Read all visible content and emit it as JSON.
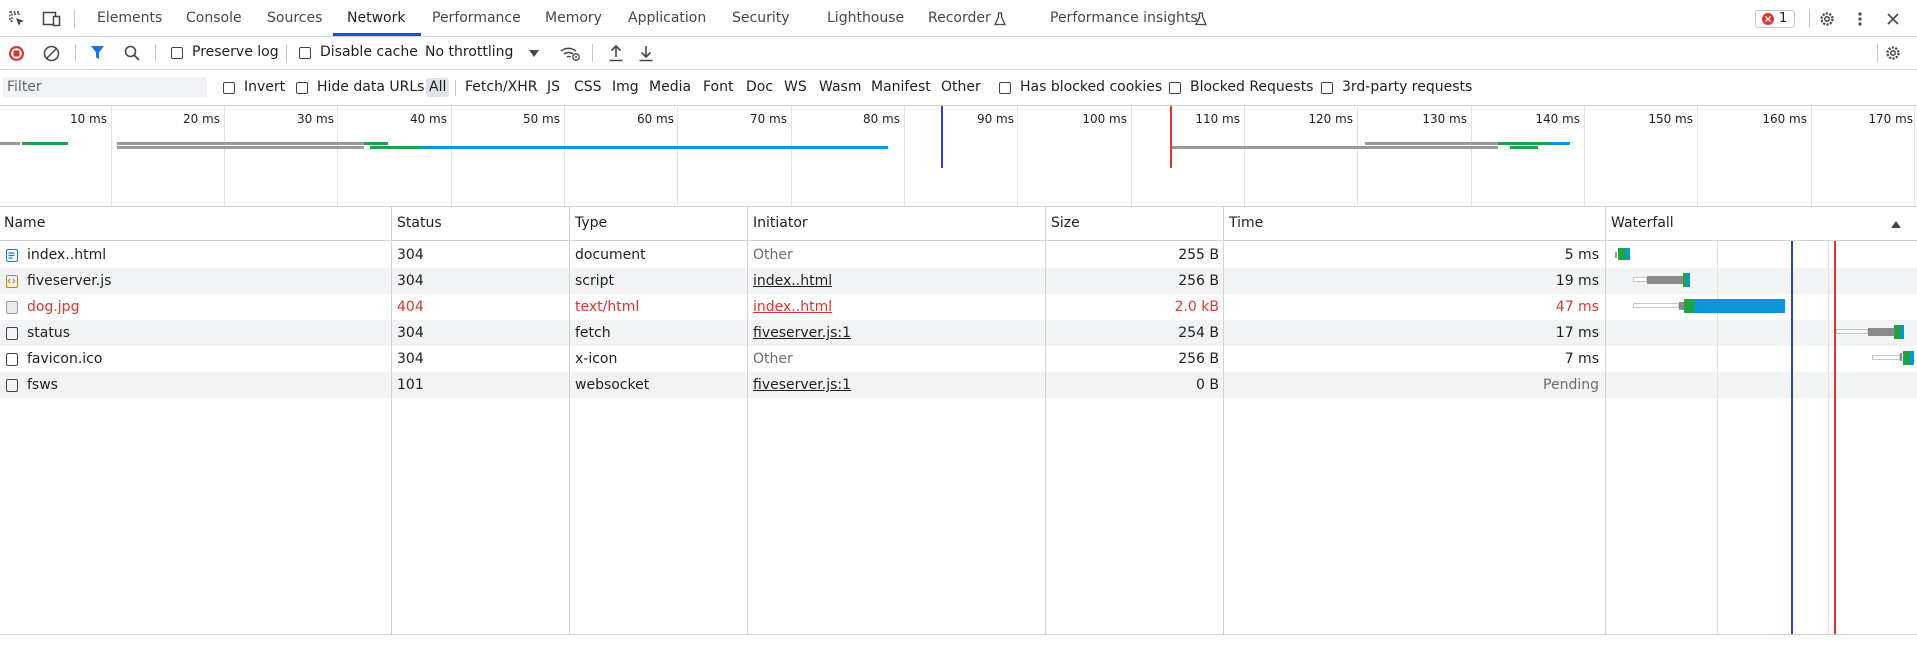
{
  "tabs": [
    {
      "label": "Elements"
    },
    {
      "label": "Console"
    },
    {
      "label": "Sources"
    },
    {
      "label": "Network",
      "active": true
    },
    {
      "label": "Performance"
    },
    {
      "label": "Memory"
    },
    {
      "label": "Application"
    },
    {
      "label": "Security"
    },
    {
      "label": "Lighthouse"
    },
    {
      "label": "Recorder"
    },
    {
      "label": "Performance insights"
    }
  ],
  "error_count": "1",
  "toolbar": {
    "preserve_log": "Preserve log",
    "disable_cache": "Disable cache",
    "throttling": "No throttling"
  },
  "filter": {
    "placeholder": "Filter",
    "invert": "Invert",
    "hide_data_urls": "Hide data URLs",
    "types": [
      "All",
      "Fetch/XHR",
      "JS",
      "CSS",
      "Img",
      "Media",
      "Font",
      "Doc",
      "WS",
      "Wasm",
      "Manifest",
      "Other"
    ],
    "has_blocked_cookies": "Has blocked cookies",
    "blocked_requests": "Blocked Requests",
    "third_party": "3rd-party requests"
  },
  "overview_ticks": [
    "10 ms",
    "20 ms",
    "30 ms",
    "40 ms",
    "50 ms",
    "60 ms",
    "70 ms",
    "80 ms",
    "90 ms",
    "100 ms",
    "110 ms",
    "120 ms",
    "130 ms",
    "140 ms",
    "150 ms",
    "160 ms",
    "170 ms"
  ],
  "columns": {
    "name": "Name",
    "status": "Status",
    "type": "Type",
    "initiator": "Initiator",
    "size": "Size",
    "time": "Time",
    "waterfall": "Waterfall"
  },
  "rows": [
    {
      "name": "index..html",
      "status": "304",
      "type": "document",
      "initiator": "Other",
      "size": "255 B",
      "time": "5 ms"
    },
    {
      "name": "fiveserver.js",
      "status": "304",
      "type": "script",
      "initiator": "index..html",
      "size": "256 B",
      "time": "19 ms"
    },
    {
      "name": "dog.jpg",
      "status": "404",
      "type": "text/html",
      "initiator": "index..html",
      "size": "2.0 kB",
      "time": "47 ms"
    },
    {
      "name": "status",
      "status": "304",
      "type": "fetch",
      "initiator": "fiveserver.js:1",
      "size": "254 B",
      "time": "17 ms"
    },
    {
      "name": "favicon.ico",
      "status": "304",
      "type": "x-icon",
      "initiator": "Other",
      "size": "256 B",
      "time": "7 ms"
    },
    {
      "name": "fsws",
      "status": "101",
      "type": "websocket",
      "initiator": "fiveserver.js:1",
      "size": "0 B",
      "time": "Pending"
    }
  ],
  "colors": {
    "accent": "#0b57d0",
    "error": "#dc362e",
    "waiting_green": "#1ea446",
    "download_blue": "#0a97d9",
    "dom_content_loaded_line": "#2f3bd1",
    "load_line": "#dc362e"
  }
}
